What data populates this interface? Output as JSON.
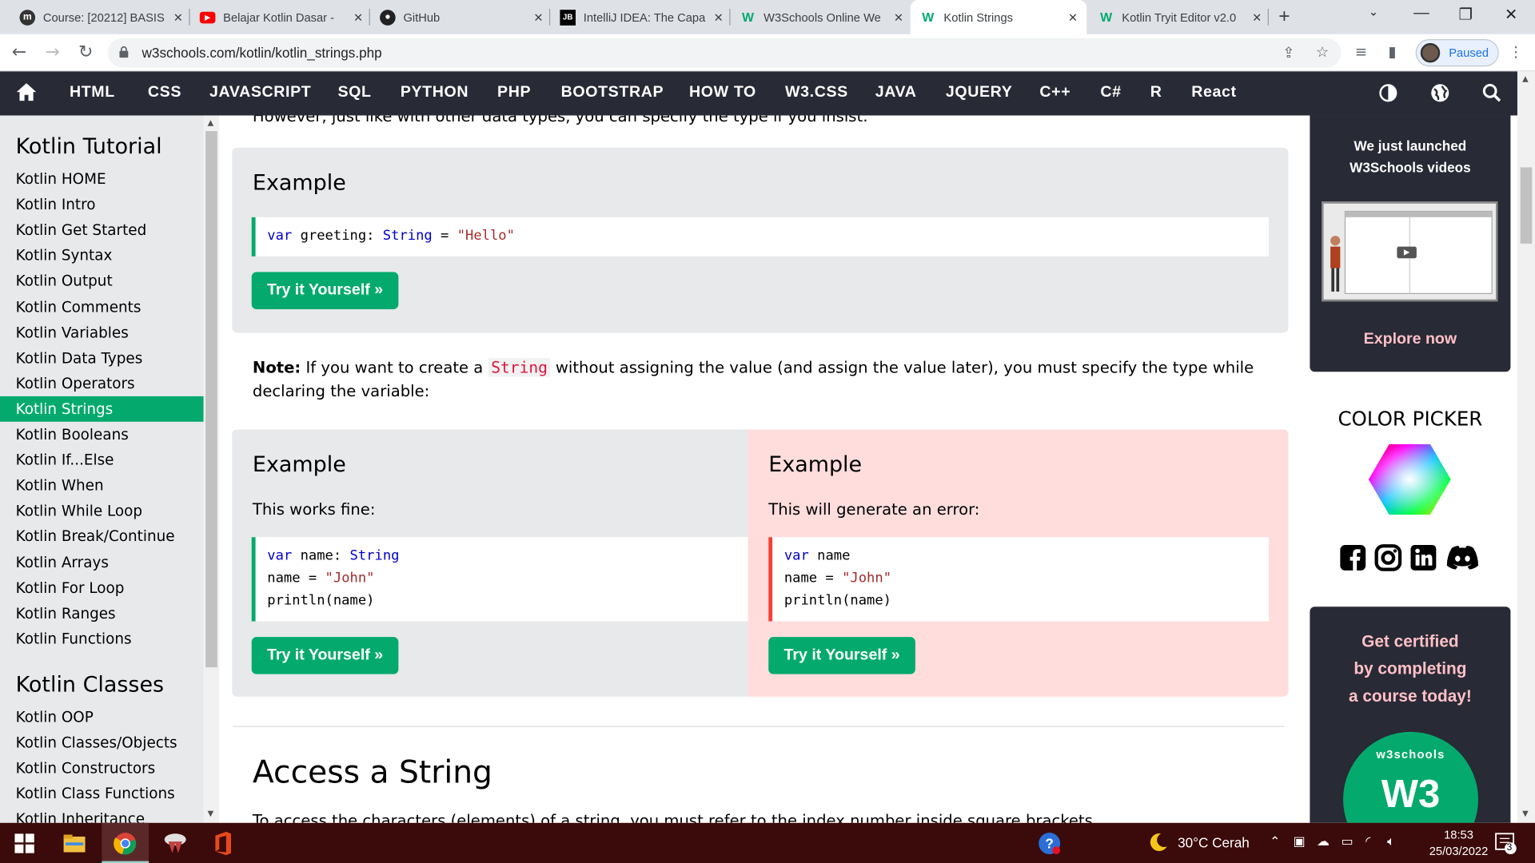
{
  "browser": {
    "tabs": [
      {
        "label": "Course: [20212] BASIS",
        "favicon": "moodle-icon"
      },
      {
        "label": "Belajar Kotlin Dasar -",
        "favicon": "youtube-icon"
      },
      {
        "label": "GitHub",
        "favicon": "github-icon"
      },
      {
        "label": "IntelliJ IDEA: The Capa",
        "favicon": "jetbrains-icon"
      },
      {
        "label": "W3Schools Online We",
        "favicon": "w3schools-icon"
      },
      {
        "label": "Kotlin Strings",
        "favicon": "w3schools-icon",
        "active": true
      },
      {
        "label": "Kotlin Tryit Editor v2.0",
        "favicon": "w3schools-icon"
      }
    ],
    "new_tab": "+",
    "url": "w3schools.com/kotlin/kotlin_strings.php",
    "profile_status": "Paused"
  },
  "topnav": {
    "links": [
      "HTML",
      "CSS",
      "JAVASCRIPT",
      "SQL",
      "PYTHON",
      "PHP",
      "BOOTSTRAP",
      "HOW TO",
      "W3.CSS",
      "JAVA",
      "JQUERY",
      "C++",
      "C#",
      "R",
      "React"
    ]
  },
  "sidebar": {
    "heading1": "Kotlin Tutorial",
    "items1": [
      "Kotlin HOME",
      "Kotlin Intro",
      "Kotlin Get Started",
      "Kotlin Syntax",
      "Kotlin Output",
      "Kotlin Comments",
      "Kotlin Variables",
      "Kotlin Data Types",
      "Kotlin Operators",
      "Kotlin Strings",
      "Kotlin Booleans",
      "Kotlin If...Else",
      "Kotlin When",
      "Kotlin While Loop",
      "Kotlin Break/Continue",
      "Kotlin Arrays",
      "Kotlin For Loop",
      "Kotlin Ranges",
      "Kotlin Functions"
    ],
    "active_item": "Kotlin Strings",
    "heading2": "Kotlin Classes",
    "items2": [
      "Kotlin OOP",
      "Kotlin Classes/Objects",
      "Kotlin Constructors",
      "Kotlin Class Functions",
      "Kotlin Inheritance"
    ]
  },
  "main": {
    "cut_top_text": "However, just like with other data types, you can specify the type if you insist:",
    "example1": {
      "heading": "Example",
      "code": {
        "kw": "var",
        "name": " greeting: ",
        "type": "String",
        "eq": " = ",
        "value": "\"Hello\""
      },
      "button": "Try it Yourself »"
    },
    "note": {
      "bold": "Note:",
      "before": " If you want to create a ",
      "code": "String",
      "after": " without assigning the value (and assign the value later), you must specify the type while declaring the variable:"
    },
    "example_ok": {
      "heading": "Example",
      "desc": "This works fine:",
      "line1_kw": "var",
      "line1_rest": " name: ",
      "line1_type": "String",
      "line2_a": "name = ",
      "line2_str": "\"John\"",
      "line3": "println(name)",
      "button": "Try it Yourself »"
    },
    "example_err": {
      "heading": "Example",
      "desc": "This will generate an error:",
      "line1_kw": "var",
      "line1_rest": " name",
      "line2_a": "name = ",
      "line2_str": "\"John\"",
      "line3": "println(name)",
      "button": "Try it Yourself »"
    },
    "section_heading": "Access a String",
    "cut_bottom_text": "To access the characters (elements) of a string, you must refer to the index number inside square brackets."
  },
  "right": {
    "ad1_title_line1": "We just launched",
    "ad1_title_line2": "W3Schools videos",
    "ad1_cta": "Explore now",
    "color_picker": "COLOR PICKER",
    "cert_line1": "Get certified",
    "cert_line2": "by completing",
    "cert_line3": "a course today!",
    "cert_logo_text": "w3schools",
    "cert_logo_mark": "W3"
  },
  "taskbar": {
    "weather": "30°C  Cerah",
    "time": "18:53",
    "date": "25/03/2022",
    "notifications": "3"
  },
  "colors": {
    "w3_green": "#04aa6d",
    "nav_dark": "#282a35",
    "error_pink": "#ffdddd",
    "pink_text": "#ffc0c7"
  }
}
